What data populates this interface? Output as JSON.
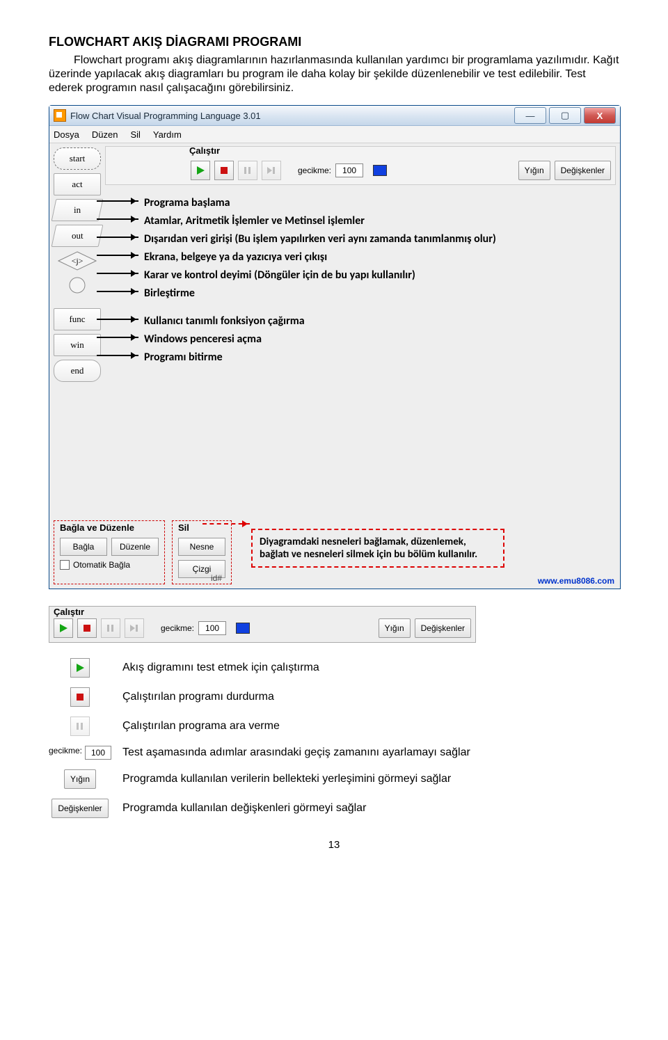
{
  "title": "FLOWCHART AKIŞ DİAGRAMI PROGRAMI",
  "paragraph": "Flowchart programı akış diagramlarının hazırlanmasında kullanılan yardımcı bir programlama yazılımıdır. Kağıt üzerinde yapılacak akış diagramları bu program ile daha kolay bir şekilde düzenlenebilir ve test edilebilir. Test ederek programın nasıl çalışacağını görebilirsiniz.",
  "window": {
    "title": "Flow Chart Visual Programming Language 3.01",
    "controls": {
      "min": "—",
      "max": "▢",
      "close": "X"
    },
    "menu": [
      "Dosya",
      "Düzen",
      "Sil",
      "Yardım"
    ],
    "run_label": "Çalıştır",
    "delay_label": "gecikme:",
    "delay_value": "100",
    "stack_btn": "Yığın",
    "vars_btn": "Değişkenler",
    "toolbox": [
      "start",
      "act",
      "in",
      "out",
      "⟨j⟩",
      "○",
      "func",
      "win",
      "end"
    ],
    "descriptions": [
      "Programa başlama",
      "Atamlar, Aritmetik İşlemler ve Metinsel işlemler",
      "Dışarıdan veri girişi (Bu işlem yapılırken veri aynı zamanda tanımlanmış olur)",
      "Ekrana, belgeye ya da yazıcıya veri çıkışı",
      "Karar ve kontrol deyimi (Döngüler için de bu yapı kullanılır)",
      "Birleştirme",
      "Kullanıcı tanımlı fonksiyon çağırma",
      "Windows penceresi açma",
      "Programı bitirme"
    ],
    "groups": {
      "g1": {
        "label": "Bağla ve Düzenle",
        "btns": [
          "Bağla",
          "Düzenle"
        ],
        "chk": "Otomatik Bağla"
      },
      "g2": {
        "label": "Sil",
        "btns": [
          "Nesne",
          "Çizgi"
        ]
      }
    },
    "red_note": "Diyagramdaki nesneleri bağlamak, düzenlemek, bağlatı ve nesneleri silmek için bu bölüm kullanılır.",
    "site": "www.emu8086.com",
    "id": "id#"
  },
  "toolbar2": {
    "label": "Çalıştır",
    "delay_label": "gecikme:",
    "delay_value": "100",
    "stack": "Yığın",
    "vars": "Değişkenler"
  },
  "explain": [
    "Akış digramını test etmek için çalıştırma",
    "Çalıştırılan programı durdurma",
    "Çalıştırılan programa ara verme",
    "Test aşamasında adımlar arasındaki geçiş zamanını ayarlamayı sağlar",
    "Programda kullanılan verilerin bellekteki yerleşimini görmeyi sağlar",
    "Programda kullanılan değişkenleri görmeyi sağlar"
  ],
  "explain_icons": {
    "gec_label": "gecikme:",
    "gec_value": "100",
    "stack": "Yığın",
    "vars": "Değişkenler"
  },
  "page_number": "13"
}
